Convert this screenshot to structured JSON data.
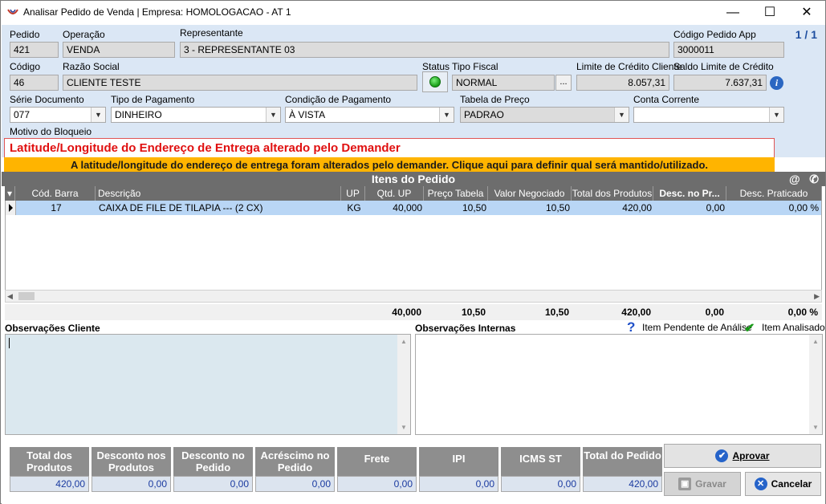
{
  "window": {
    "title": "Analisar Pedido de Venda | Empresa: HOMOLOGACAO - AT 1",
    "minimize": "—",
    "maximize": "☐",
    "close": "✕"
  },
  "header": {
    "page_indicator": "1 / 1",
    "pedido": {
      "label": "Pedido",
      "value": "421"
    },
    "operacao": {
      "label": "Operação",
      "value": "VENDA"
    },
    "representante": {
      "label": "Representante",
      "value": "3 - REPRESENTANTE 03"
    },
    "codigo_pedido_app": {
      "label": "Código Pedido App",
      "value": "3000011"
    },
    "codigo": {
      "label": "Código",
      "value": "46"
    },
    "razao_social": {
      "label": "Razão Social",
      "value": "CLIENTE TESTE"
    },
    "status": {
      "label": "Status",
      "color": "#1fb81f"
    },
    "tipo_fiscal": {
      "label": "Tipo Fiscal",
      "value": "NORMAL",
      "button": "..."
    },
    "limite_credito": {
      "label": "Limite de Crédito Cliente",
      "value": "8.057,31"
    },
    "saldo_limite": {
      "label": "Saldo Limite de Crédito",
      "value": "7.637,31",
      "info_icon": "i"
    },
    "serie_documento": {
      "label": "Série Documento",
      "value": "077"
    },
    "tipo_pagamento": {
      "label": "Tipo de Pagamento",
      "value": "DINHEIRO"
    },
    "condicao_pagamento": {
      "label": "Condição de Pagamento",
      "value": "À VISTA"
    },
    "tabela_preco": {
      "label": "Tabela de Preço",
      "value": "PADRAO"
    },
    "conta_corrente": {
      "label": "Conta Corrente",
      "value": ""
    },
    "motivo_bloqueio": {
      "label": "Motivo do Bloqueio"
    }
  },
  "alerts": {
    "block_reason": "Latitude/Longitude do Endereço de Entrega alterado pelo Demander",
    "warning": "A latitude/longitude do endereço de entrega foram alterados pelo demander. Clique aqui para definir qual será mantido/utilizado."
  },
  "grid": {
    "title": "Itens do Pedido",
    "icons": {
      "email": "@",
      "whatsapp": "✆"
    },
    "columns": [
      "Cód. Barra",
      "Descrição",
      "UP",
      "Qtd. UP",
      "Preço Tabela",
      "Valor Negociado",
      "Total dos Produtos",
      "Desc. no Pr...",
      "Desc. Praticado"
    ],
    "rows": [
      [
        "17",
        "CAIXA DE FILE DE TILAPIA --- (2 CX)",
        "KG",
        "40,000",
        "10,50",
        "10,50",
        "420,00",
        "0,00",
        "0,00 %"
      ]
    ],
    "totals": [
      "40,000",
      "10,50",
      "10,50",
      "420,00",
      "0,00",
      "0,00 %"
    ]
  },
  "observations": {
    "cliente_label": "Observações Cliente",
    "interna_label": "Observações Internas",
    "legend_pending": "Item Pendente de Análise",
    "legend_analyzed": "Item Analisado",
    "pending_icon": "?",
    "analyzed_icon": "✔",
    "cliente_value": "",
    "interna_value": ""
  },
  "summary": {
    "total_produtos": {
      "label": "Total dos Produtos",
      "value": "420,00"
    },
    "desconto_produtos": {
      "label": "Desconto nos Produtos",
      "value": "0,00"
    },
    "desconto_pedido": {
      "label": "Desconto no Pedido",
      "value": "0,00"
    },
    "acrescimo_pedido": {
      "label": "Acréscimo no Pedido",
      "value": "0,00"
    },
    "frete": {
      "label": "Frete",
      "value": "0,00"
    },
    "ipi": {
      "label": "IPI",
      "value": "0,00"
    },
    "icms_st": {
      "label": "ICMS ST",
      "value": "0,00"
    },
    "total_pedido": {
      "label": "Total do Pedido",
      "value": "420,00"
    }
  },
  "buttons": {
    "approve": "Aprovar",
    "save": "Gravar",
    "cancel": "Cancelar"
  }
}
